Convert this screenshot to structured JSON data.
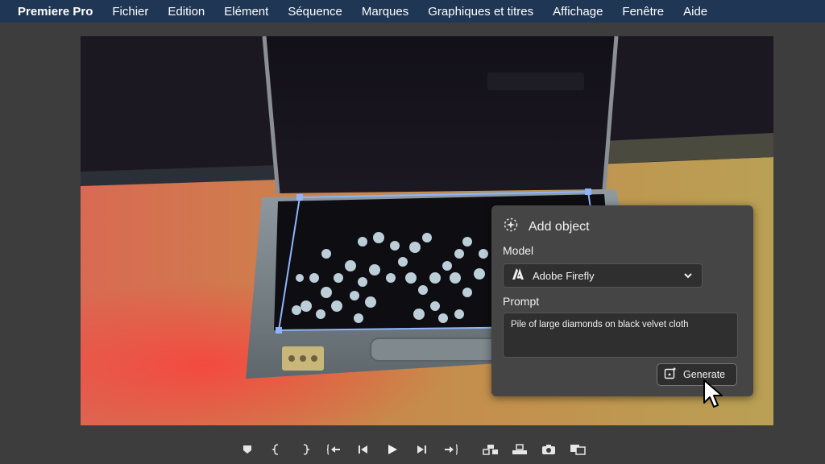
{
  "menubar": {
    "app_name": "Premiere Pro",
    "items": [
      "Fichier",
      "Edition",
      "Elément",
      "Séquence",
      "Marques",
      "Graphiques et titres",
      "Affichage",
      "Fenêtre",
      "Aide"
    ]
  },
  "panel": {
    "title": "Add object",
    "model_label": "Model",
    "model_value": "Adobe Firefly",
    "prompt_label": "Prompt",
    "prompt_value": "Pile of large diamonds on black velvet cloth",
    "generate_label": "Generate"
  },
  "playback_controls": [
    "add-marker",
    "mark-in",
    "mark-out",
    "go-to-in",
    "step-back",
    "play",
    "step-forward",
    "go-to-out",
    "insert",
    "overwrite",
    "export-frame",
    "compare-view"
  ],
  "colors": {
    "menubar_bg": "#1f3654",
    "panel_bg": "#454545",
    "selection_outline": "#8fb4ff",
    "app_bg": "#3d3d3d"
  }
}
